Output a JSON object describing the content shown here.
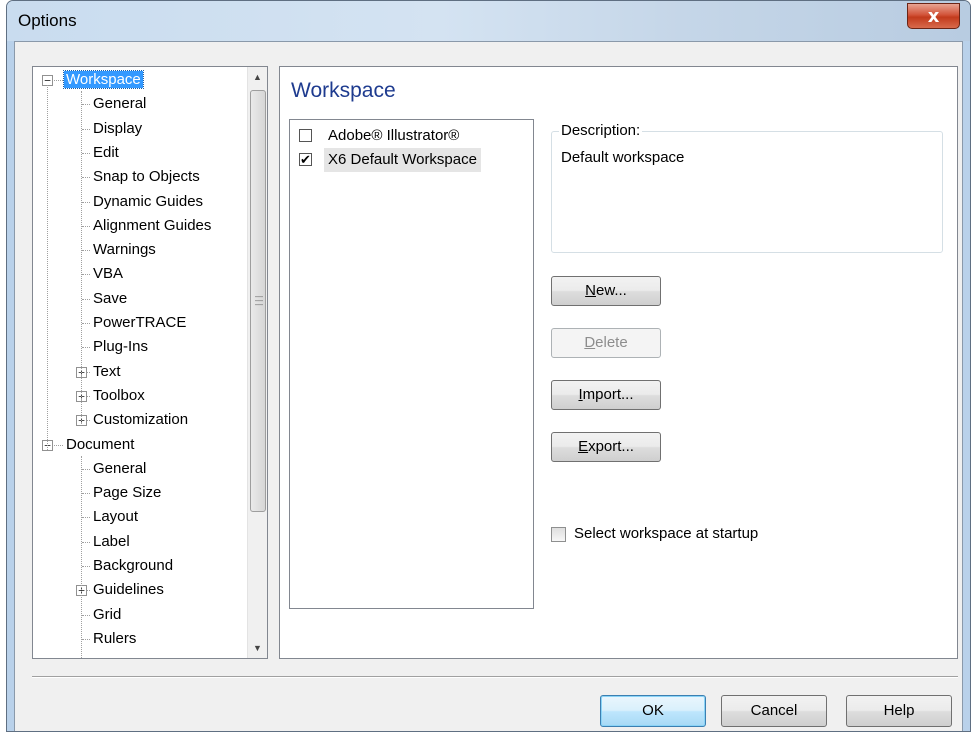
{
  "window": {
    "title": "Options",
    "close_glyph": "x"
  },
  "tree": {
    "items": [
      {
        "label": "Workspace",
        "level": 0,
        "expander": "−",
        "selected": true
      },
      {
        "label": "General",
        "level": 1
      },
      {
        "label": "Display",
        "level": 1
      },
      {
        "label": "Edit",
        "level": 1
      },
      {
        "label": "Snap to Objects",
        "level": 1
      },
      {
        "label": "Dynamic Guides",
        "level": 1
      },
      {
        "label": "Alignment Guides",
        "level": 1
      },
      {
        "label": "Warnings",
        "level": 1
      },
      {
        "label": "VBA",
        "level": 1
      },
      {
        "label": "Save",
        "level": 1
      },
      {
        "label": "PowerTRACE",
        "level": 1
      },
      {
        "label": "Plug-Ins",
        "level": 1
      },
      {
        "label": "Text",
        "level": 1,
        "expander": "+"
      },
      {
        "label": "Toolbox",
        "level": 1,
        "expander": "+"
      },
      {
        "label": "Customization",
        "level": 1,
        "expander": "+"
      },
      {
        "label": "Document",
        "level": 0,
        "expander": "−"
      },
      {
        "label": "General",
        "level": 1
      },
      {
        "label": "Page Size",
        "level": 1
      },
      {
        "label": "Layout",
        "level": 1
      },
      {
        "label": "Label",
        "level": 1
      },
      {
        "label": "Background",
        "level": 1
      },
      {
        "label": "Guidelines",
        "level": 1,
        "expander": "+"
      },
      {
        "label": "Grid",
        "level": 1
      },
      {
        "label": "Rulers",
        "level": 1
      }
    ]
  },
  "panel": {
    "title": "Workspace",
    "workspaces": [
      {
        "label": "Adobe® Illustrator®",
        "checked": false
      },
      {
        "label": "X6 Default Workspace",
        "checked": true
      }
    ],
    "description_label": "Description:",
    "description_text": "Default workspace",
    "buttons": {
      "new": {
        "mnemonic": "N",
        "rest": "ew..."
      },
      "delete": {
        "mnemonic": "D",
        "rest": "elete"
      },
      "import": {
        "mnemonic": "I",
        "rest": "mport..."
      },
      "export": {
        "mnemonic": "E",
        "rest": "xport..."
      }
    },
    "startup_label": "Select workspace at startup"
  },
  "footer": {
    "ok": "OK",
    "cancel": "Cancel",
    "help": "Help"
  }
}
